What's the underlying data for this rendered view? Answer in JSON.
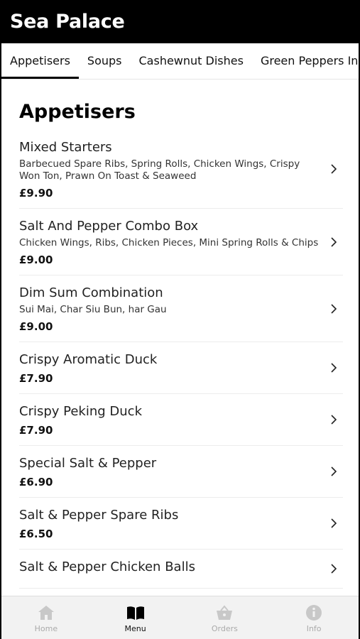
{
  "app": {
    "title": "Sea Palace"
  },
  "tabs": [
    {
      "label": "Appetisers",
      "active": true
    },
    {
      "label": "Soups",
      "active": false
    },
    {
      "label": "Cashewnut Dishes",
      "active": false
    },
    {
      "label": "Green Peppers In B",
      "active": false
    }
  ],
  "section": {
    "title": "Appetisers"
  },
  "items": [
    {
      "name": "Mixed Starters",
      "desc": "Barbecued Spare Ribs, Spring Rolls, Chicken Wings, Crispy Won Ton, Prawn On Toast & Seaweed",
      "price": "£9.90"
    },
    {
      "name": "Salt And Pepper Combo Box",
      "desc": "Chicken Wings, Ribs, Chicken Pieces, Mini Spring Rolls & Chips",
      "price": "£9.00"
    },
    {
      "name": "Dim Sum Combination",
      "desc": "Sui Mai, Char Siu Bun, har Gau",
      "price": "£9.00"
    },
    {
      "name": "Crispy Aromatic Duck",
      "desc": "",
      "price": "£7.90"
    },
    {
      "name": "Crispy Peking Duck",
      "desc": "",
      "price": "£7.90"
    },
    {
      "name": "Special Salt & Pepper",
      "desc": "",
      "price": "£6.90"
    },
    {
      "name": "Salt & Pepper Spare Ribs",
      "desc": "",
      "price": "£6.50"
    },
    {
      "name": "Salt & Pepper Chicken Balls",
      "desc": "",
      "price": ""
    }
  ],
  "bottom_nav": {
    "home": {
      "label": "Home",
      "icon": "home-icon"
    },
    "menu": {
      "label": "Menu",
      "icon": "book-icon"
    },
    "orders": {
      "label": "Orders",
      "icon": "basket-icon"
    },
    "info": {
      "label": "Info",
      "icon": "info-icon"
    }
  },
  "colors": {
    "header_bg": "#000000",
    "accent": "#000000",
    "nav_bg": "#f2f2f2",
    "nav_inactive": "#aaaaaa"
  }
}
